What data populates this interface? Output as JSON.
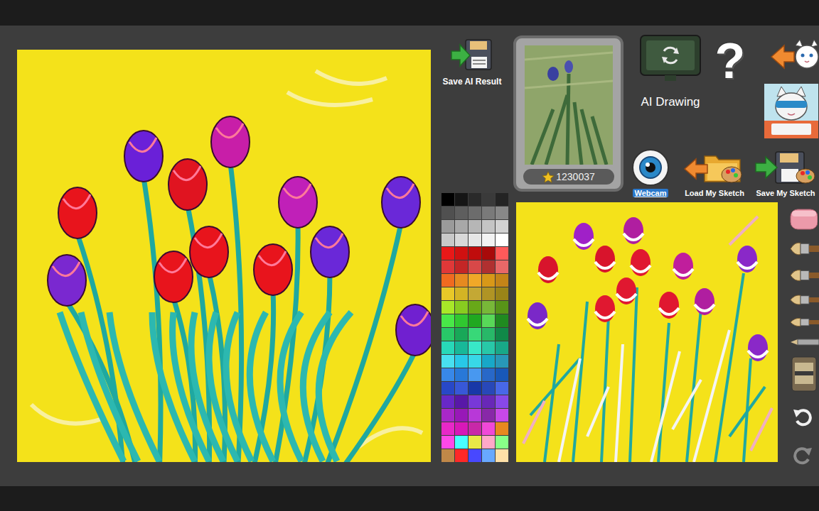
{
  "save_ai": {
    "label": "Save AI Result"
  },
  "reference": {
    "count": "1230037"
  },
  "ai_drawing": {
    "label": "AI Drawing"
  },
  "help": {
    "glyph": "?"
  },
  "sketch_actions": [
    {
      "kind": "webcam",
      "label": "Webcam",
      "selected": true
    },
    {
      "kind": "load",
      "label": "Load My Sketch",
      "selected": false
    },
    {
      "kind": "save",
      "label": "Save My Sketch",
      "selected": false
    }
  ],
  "palette": [
    "#000000",
    "#151515",
    "#2a2a2a",
    "#3a3a3a",
    "#242424",
    "#505050",
    "#5e5e5e",
    "#6c6c6c",
    "#7a7a7a",
    "#888888",
    "#9a9a9a",
    "#a8a8a8",
    "#b6b6b6",
    "#c4c4c4",
    "#d2d2d2",
    "#c8c8c8",
    "#d8d8d8",
    "#e6e6e6",
    "#f2f2f2",
    "#ffffff",
    "#e81818",
    "#d01010",
    "#c00c0c",
    "#a80a0a",
    "#ff5a5a",
    "#e03838",
    "#c42626",
    "#d84848",
    "#b03030",
    "#e86868",
    "#f06a20",
    "#e68a20",
    "#f0a828",
    "#d89818",
    "#c48418",
    "#e8c828",
    "#d4b424",
    "#c4a834",
    "#b09424",
    "#9a8418",
    "#a8e828",
    "#88cc20",
    "#68a818",
    "#78b838",
    "#589418",
    "#48e848",
    "#30c830",
    "#20a820",
    "#58d858",
    "#208a20",
    "#28c868",
    "#18a858",
    "#38d878",
    "#28b868",
    "#108848",
    "#28d8b8",
    "#18b898",
    "#38e8c8",
    "#28c8a8",
    "#18a888",
    "#48e0f0",
    "#28c8e8",
    "#38d8e8",
    "#18a8c8",
    "#2898b8",
    "#3888e8",
    "#2878d8",
    "#4898f0",
    "#2868c8",
    "#1858b8",
    "#2848c8",
    "#3858d8",
    "#1838a8",
    "#2848b8",
    "#4868e8",
    "#6828c8",
    "#5818a8",
    "#7838d8",
    "#6828b8",
    "#8848e8",
    "#a828c8",
    "#9818b8",
    "#b838d8",
    "#8828a8",
    "#c848e8",
    "#e828c8",
    "#d818b8",
    "#c828a8",
    "#f048d8",
    "#e88820",
    "#ff48e8",
    "#48ffff",
    "#e8e848",
    "#ffa8c8",
    "#88ff88",
    "#c08848",
    "#ff2828",
    "#4848ff",
    "#68a8ff",
    "#ffe0a8"
  ],
  "tools": [
    {
      "kind": "eraser",
      "disabled": false
    },
    {
      "kind": "brush",
      "disabled": false
    },
    {
      "kind": "brush",
      "disabled": false
    },
    {
      "kind": "brush",
      "disabled": false
    },
    {
      "kind": "brush",
      "disabled": false
    },
    {
      "kind": "pen",
      "disabled": false
    },
    {
      "kind": "tube",
      "disabled": false
    },
    {
      "kind": "undo",
      "disabled": false
    },
    {
      "kind": "redo",
      "disabled": true
    }
  ]
}
